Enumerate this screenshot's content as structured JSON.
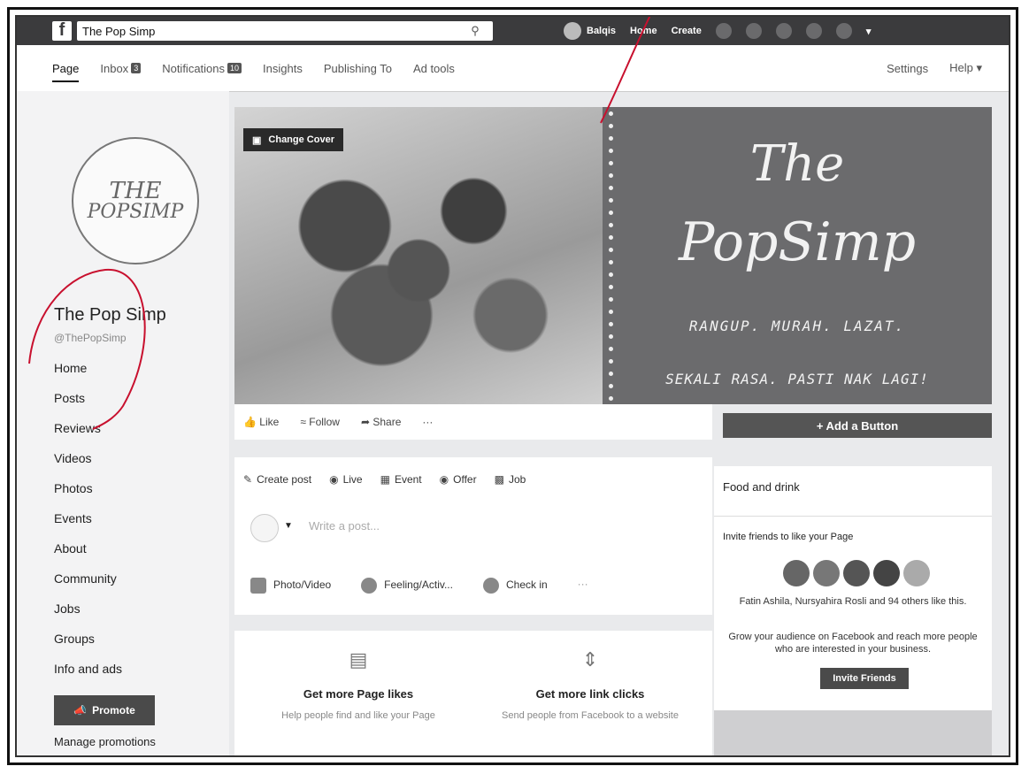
{
  "topbar": {
    "search_value": "The Pop Simp",
    "user_name": "Balqis",
    "home_label": "Home",
    "create_label": "Create"
  },
  "pagebar": {
    "tabs": [
      {
        "label": "Page",
        "badge": ""
      },
      {
        "label": "Inbox",
        "badge": "3"
      },
      {
        "label": "Notifications",
        "badge": "10"
      },
      {
        "label": "Insights",
        "badge": ""
      },
      {
        "label": "Publishing To",
        "badge": ""
      },
      {
        "label": "Ad tools",
        "badge": ""
      }
    ],
    "settings_label": "Settings",
    "help_label": "Help ▾"
  },
  "sidebar": {
    "logo_line1": "THE",
    "logo_line2": "POPSIMP",
    "page_name": "The Pop Simp",
    "page_handle": "@ThePopSimp",
    "nav": [
      "Home",
      "Posts",
      "Reviews",
      "Videos",
      "Photos",
      "Events",
      "About",
      "Community",
      "Jobs",
      "Groups",
      "Info and ads"
    ],
    "promote_label": "Promote",
    "manage_label": "Manage promotions"
  },
  "cover": {
    "change_cover_label": "Change Cover",
    "title_line1": "The",
    "title_line2": "PopSimp",
    "tagline1": "RANGUP. MURAH. LAZAT.",
    "tagline2": "SEKALI RASA. PASTI NAK LAGI!"
  },
  "actions": {
    "like": "Like",
    "follow": "Follow",
    "share": "Share",
    "more": "···",
    "add_button": "+ Add a Button"
  },
  "composer": {
    "tabs": [
      "Create post",
      "Live",
      "Event",
      "Offer",
      "Job"
    ],
    "placeholder": "Write a post...",
    "actions": [
      "Photo/Video",
      "Feeling/Activ...",
      "Check in",
      "···"
    ]
  },
  "growth": [
    {
      "title": "Get more Page likes",
      "desc": "Help people find and like your Page"
    },
    {
      "title": "Get more link clicks",
      "desc": "Send people from Facebook to a website"
    }
  ],
  "right": {
    "category": "Food and drink",
    "invite_heading": "Invite friends to like your Page",
    "likes_text": "Fatin Ashila, Nursyahira Rosli and 94 others like this.",
    "grow_text": "Grow your audience on Facebook and reach more people who are interested in your business.",
    "invite_button": "Invite Friends"
  },
  "colors": {
    "annotation": "#c8102e",
    "topbar": "#3b3b3d",
    "cover_panel": "#6b6b6d"
  }
}
